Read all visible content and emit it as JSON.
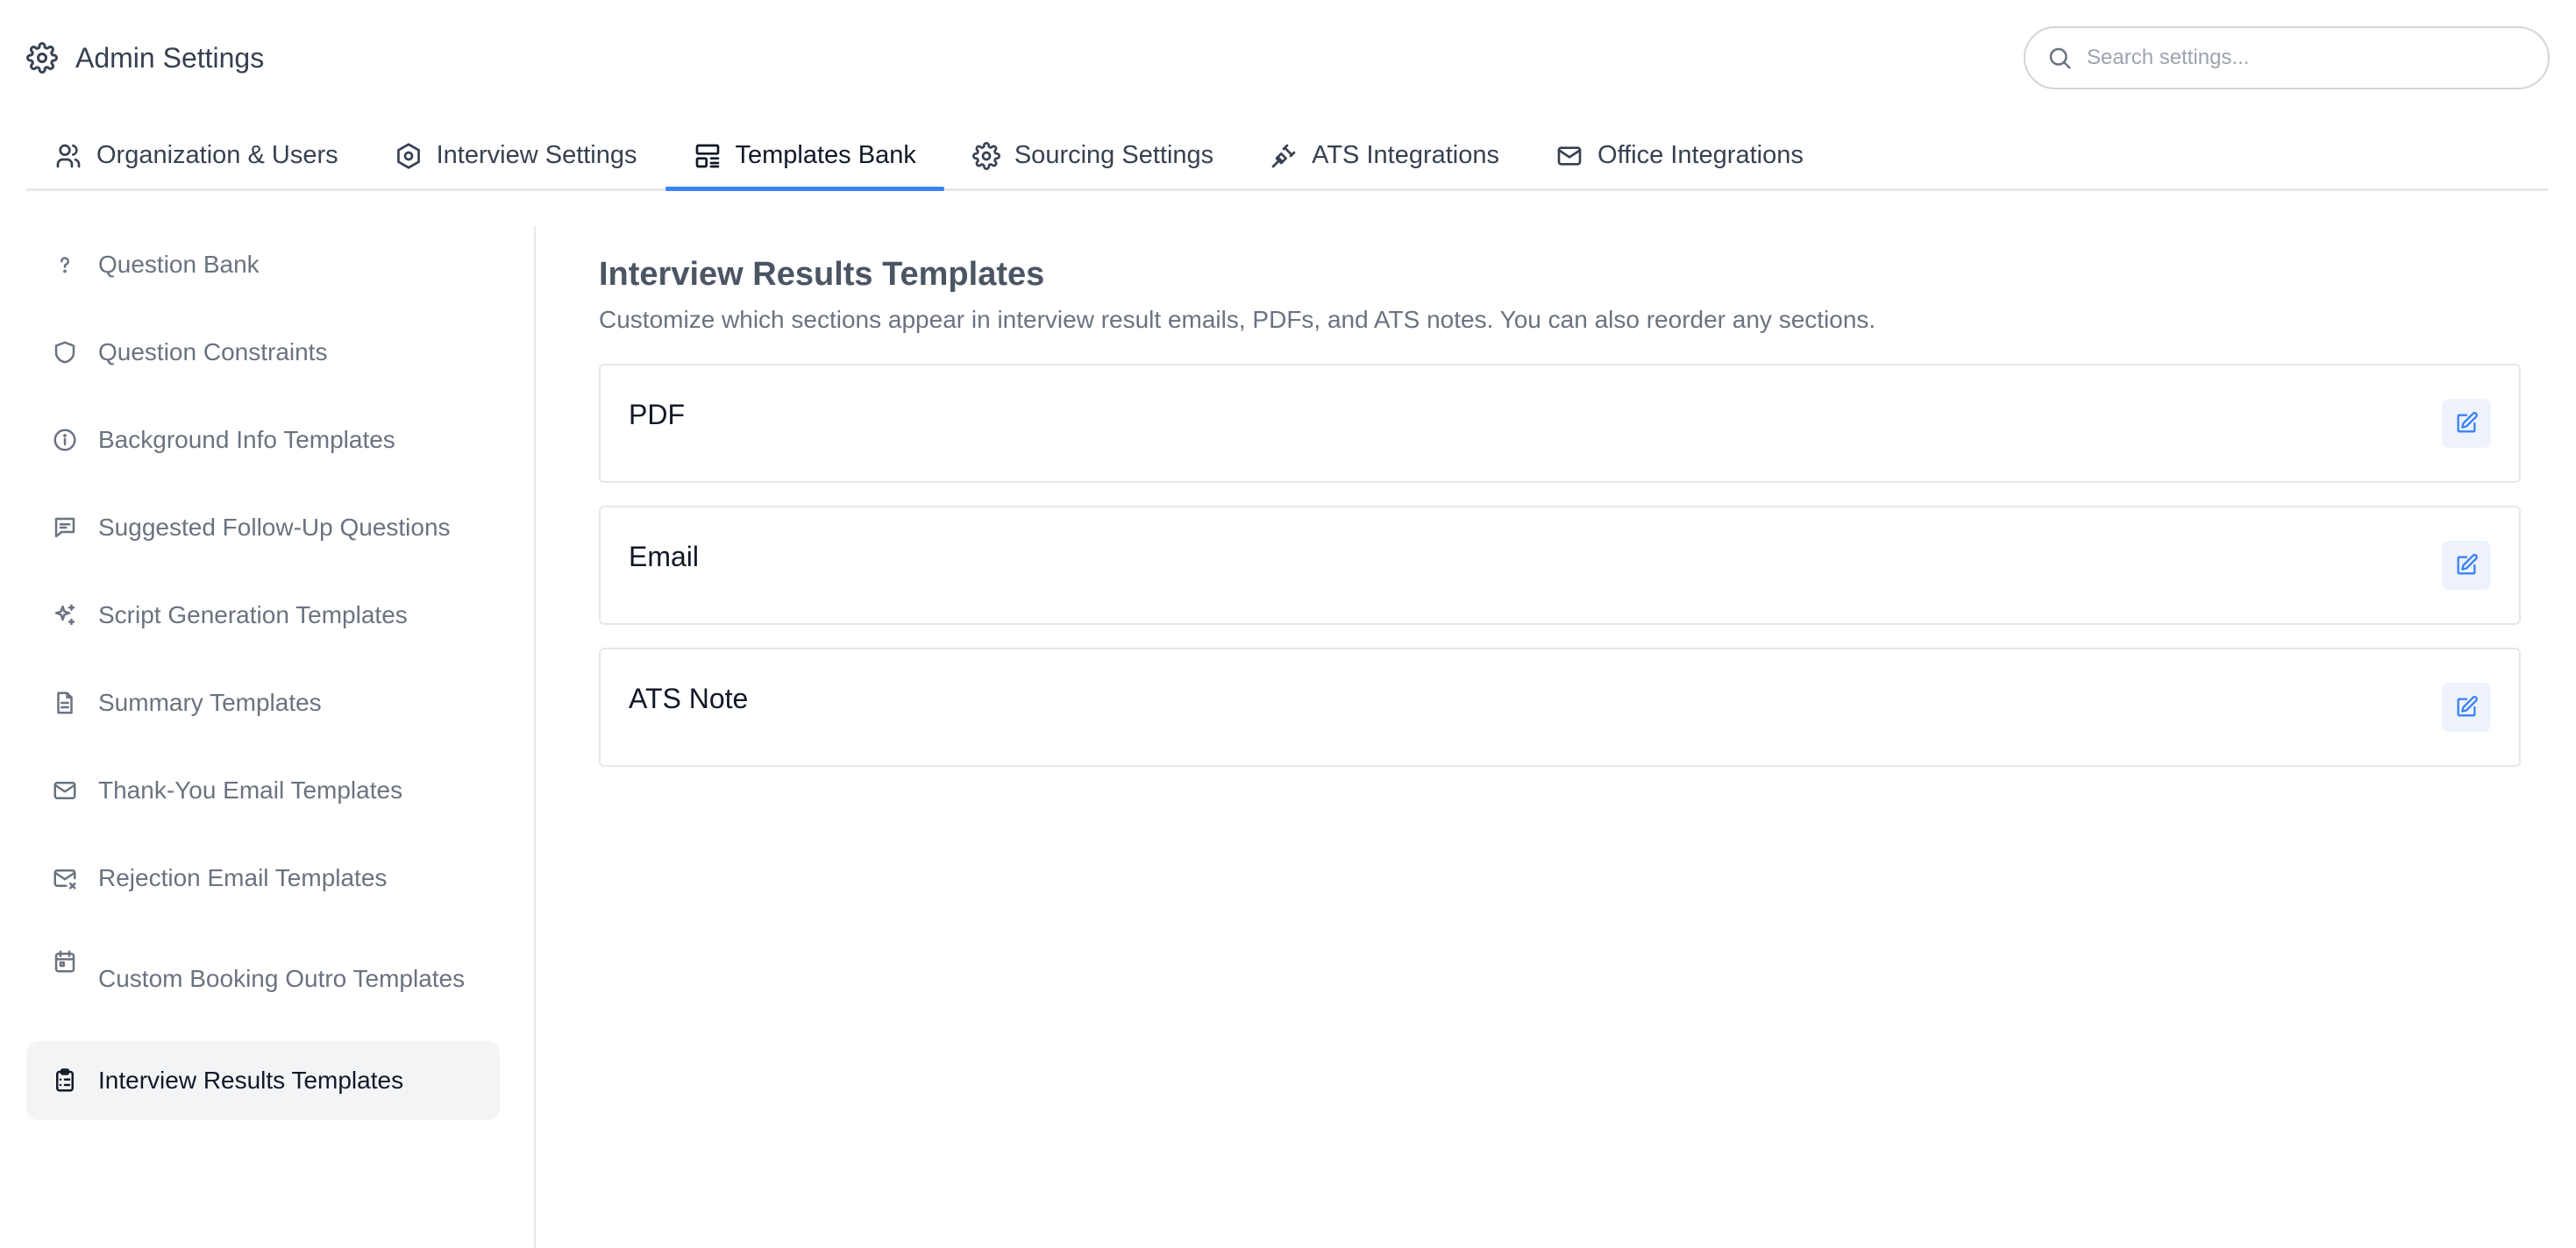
{
  "header": {
    "title": "Admin Settings",
    "icon": "gear-icon",
    "search_placeholder": "Search settings..."
  },
  "tabs": [
    {
      "label": "Organization & Users",
      "icon": "users-icon"
    },
    {
      "label": "Interview Settings",
      "icon": "hexagon-gear-icon"
    },
    {
      "label": "Templates Bank",
      "icon": "layout-template-icon",
      "active": true
    },
    {
      "label": "Sourcing Settings",
      "icon": "gear-icon"
    },
    {
      "label": "ATS Integrations",
      "icon": "plug-icon"
    },
    {
      "label": "Office Integrations",
      "icon": "mail-icon"
    }
  ],
  "sidebar": {
    "items": [
      {
        "label": "Question Bank",
        "icon": "question-mark-icon"
      },
      {
        "label": "Question Constraints",
        "icon": "shield-icon"
      },
      {
        "label": "Background Info Templates",
        "icon": "info-icon"
      },
      {
        "label": "Suggested Follow-Up Questions",
        "icon": "message-question-icon"
      },
      {
        "label": "Script Generation Templates",
        "icon": "sparkles-icon"
      },
      {
        "label": "Summary Templates",
        "icon": "file-text-icon"
      },
      {
        "label": "Thank-You Email Templates",
        "icon": "mail-icon"
      },
      {
        "label": "Rejection Email Templates",
        "icon": "mail-x-icon"
      },
      {
        "label": "Custom Booking Outro Templates",
        "icon": "calendar-icon"
      },
      {
        "label": "Interview Results Templates",
        "icon": "clipboard-list-icon",
        "active": true
      }
    ]
  },
  "main": {
    "title": "Interview Results Templates",
    "subtitle": "Customize which sections appear in interview result emails, PDFs, and ATS notes. You can also reorder any sections.",
    "cards": [
      {
        "title": "PDF"
      },
      {
        "title": "Email"
      },
      {
        "title": "ATS Note"
      }
    ]
  },
  "colors": {
    "accent": "#3b82f6",
    "active_bg": "#f3f4f6",
    "edit_bg": "#eef2fb"
  }
}
